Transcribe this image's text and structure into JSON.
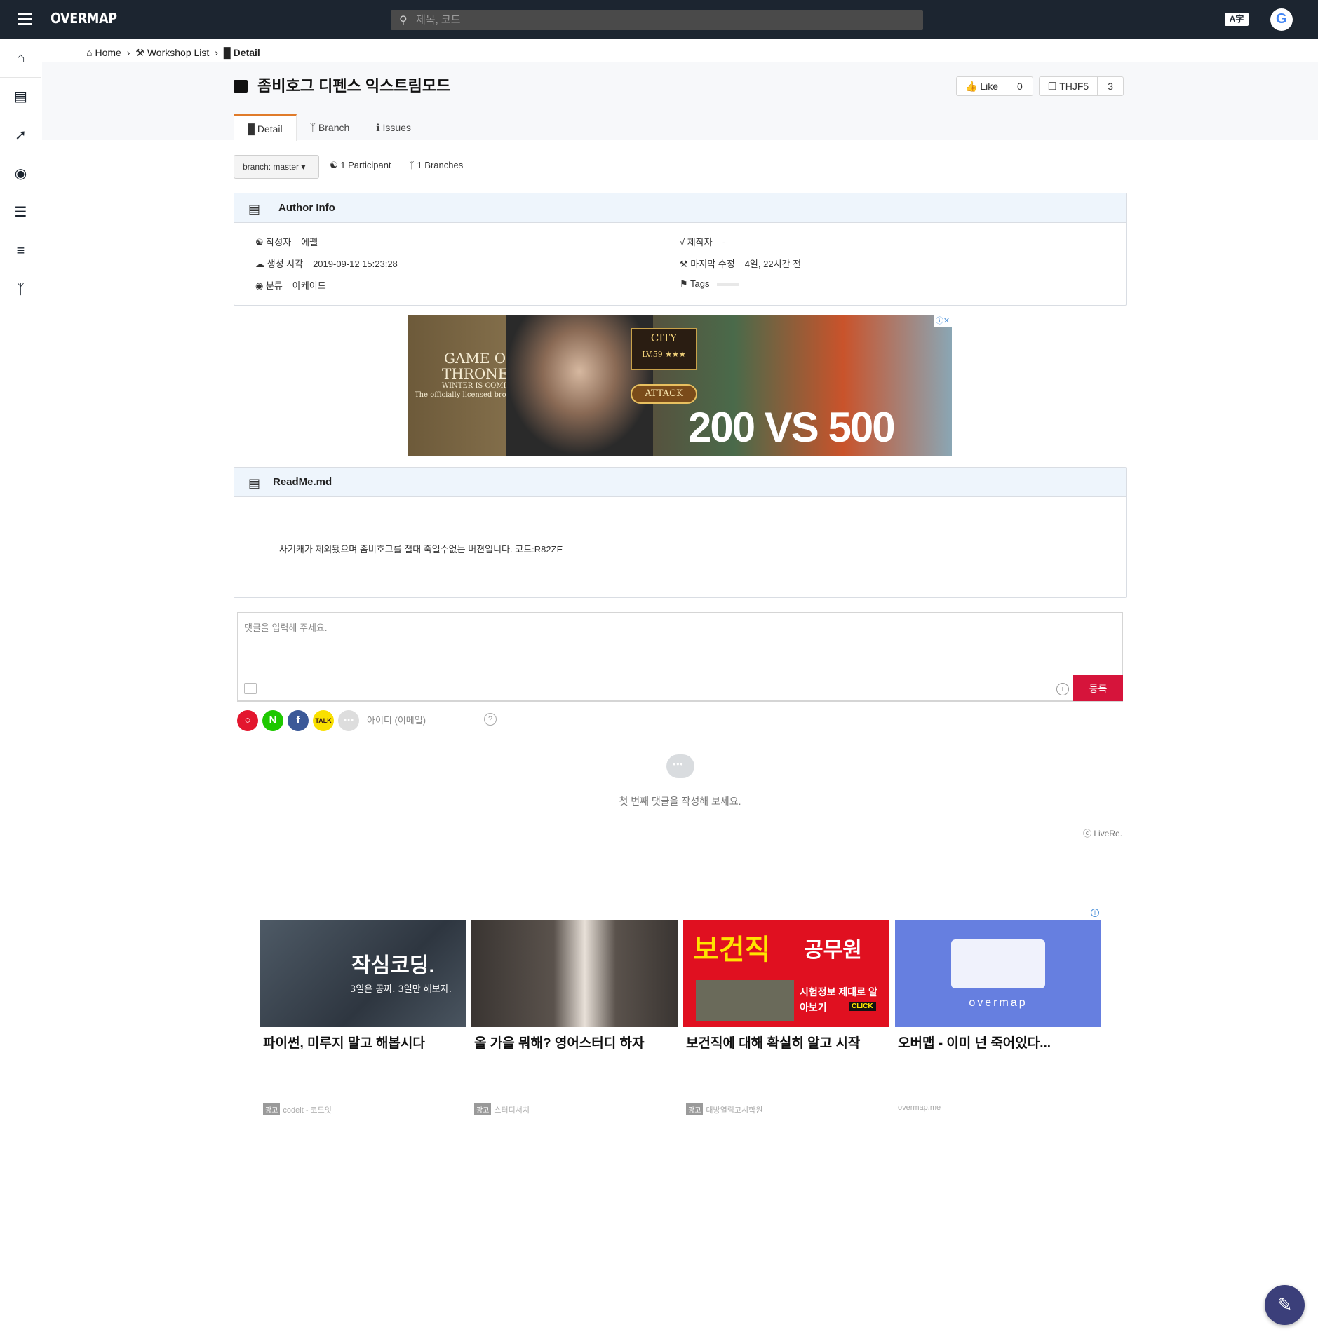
{
  "app": {
    "logo": "OVERMAP",
    "search_placeholder": "제목, 코드",
    "translate_label": "A字",
    "account_label": "G"
  },
  "breadcrumb": {
    "home": "Home",
    "workshop": "Workshop List",
    "current": "Detail"
  },
  "page": {
    "title": "좀비호그 디펜스 익스트림모드",
    "like": {
      "label": "Like",
      "count": "0"
    },
    "code": {
      "label": "THJF5",
      "count": "3"
    }
  },
  "tabs": [
    {
      "label": "Detail"
    },
    {
      "label": "Branch"
    },
    {
      "label": "Issues"
    }
  ],
  "branch": {
    "select_label": "branch: master",
    "participants": "1 Participant",
    "branches": "1 Branches"
  },
  "author_info": {
    "header": "Author Info",
    "author_key": "작성자",
    "author_val": "에펠",
    "created_key": "생성 시각",
    "created_val": "2019-09-12 15:23:28",
    "category_key": "분류",
    "category_val": "아케이드",
    "maker_key": "제작자",
    "maker_val": "-",
    "modified_key": "마지막 수정",
    "modified_val": "4일, 22시간 전",
    "tags_key": "Tags"
  },
  "banner_ad": {
    "title_line1": "GAME OF",
    "title_line2": "THRONES",
    "tagline1": "WINTER IS COMING",
    "tagline2": "The officially licensed browser game",
    "city": "CITY",
    "level": "LV.59 ★★★",
    "attack": "ATTACK",
    "versus": "200 VS 500"
  },
  "readme": {
    "header": "ReadMe.md",
    "body": "사기캐가 제외됐으며 좀비호그를 절대 죽일수없는 버젼입니다. 코드:R82ZE"
  },
  "comments": {
    "placeholder": "댓글을 입력해 주세요.",
    "submit": "등록",
    "id_placeholder": "아이디 (이메일)",
    "empty": "첫 번째 댓글을 작성해 보세요.",
    "credit": "ⓒ LiveRe."
  },
  "native_ads": [
    {
      "headline": "파이썬, 미루지 말고 해봅시다",
      "tag": "광고",
      "source": "codeit - 코드잇",
      "overlay": "작심코딩.",
      "overlay2": "3일은 공짜. 3일만 해보자."
    },
    {
      "headline": "올 가을 뭐해? 영어스터디 하자",
      "tag": "광고",
      "source": "스터디서치"
    },
    {
      "headline": "보건직에 대해 확실히 알고 시작",
      "tag": "광고",
      "source": "대방열림고시학원",
      "overlay": "보건직",
      "overlay_b": "공무원",
      "overlay2": "시험정보 제대로 알아보기",
      "click": "CLICK"
    },
    {
      "headline": "오버맵 - 이미 넌 죽어있다...",
      "tag": "",
      "source": "overmap.me",
      "overlay": "overmap"
    }
  ],
  "colors": {
    "topbar": "#1c2530",
    "accent": "#e07b2a",
    "submit": "#d6143b",
    "fab": "#3b3f7a"
  }
}
